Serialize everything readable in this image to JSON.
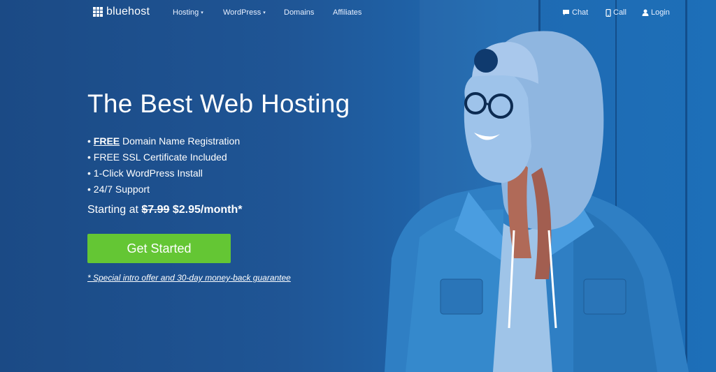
{
  "nav": {
    "logo_text": "bluehost",
    "items": [
      {
        "label": "Hosting",
        "has_dropdown": true
      },
      {
        "label": "WordPress",
        "has_dropdown": true
      },
      {
        "label": "Domains",
        "has_dropdown": false
      },
      {
        "label": "Affiliates",
        "has_dropdown": false
      }
    ],
    "right": [
      {
        "label": "Chat",
        "icon": "chat-icon"
      },
      {
        "label": "Call",
        "icon": "phone-icon"
      },
      {
        "label": "Login",
        "icon": "user-icon"
      }
    ],
    "caret": "▾"
  },
  "hero": {
    "title": "The Best Web Hosting",
    "features": [
      {
        "bullet": "• ",
        "emph": "FREE",
        "text": " Domain Name Registration"
      },
      {
        "bullet": "• ",
        "emph": "",
        "text": "FREE SSL Certificate Included"
      },
      {
        "bullet": "• ",
        "emph": "",
        "text": "1-Click WordPress Install"
      },
      {
        "bullet": "• ",
        "emph": "",
        "text": "24/7 Support"
      }
    ],
    "price_prefix": "Starting at ",
    "price_old": "$7.99",
    "price_new": "$2.95/month*",
    "cta_label": "Get Started",
    "offer_text": "* Special intro offer and 30-day money-back guarantee"
  },
  "colors": {
    "background": "#1f5595",
    "cta": "#64c634",
    "text": "#ffffff"
  }
}
